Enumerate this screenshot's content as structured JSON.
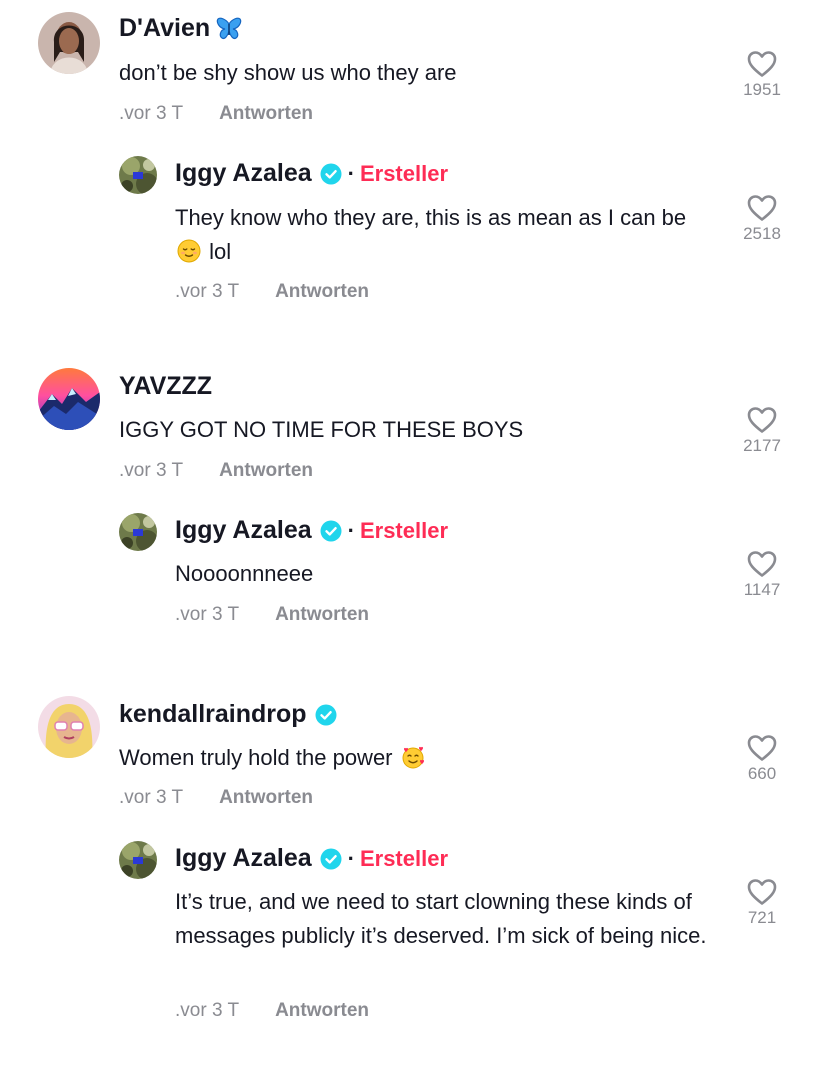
{
  "colors": {
    "creator": "#fe2c55",
    "verified": "#20d5ec",
    "muted": "#8a8b91"
  },
  "comments": [
    {
      "username": "D'Avien",
      "badge_icon": "butterfly-emoji",
      "text": "don’t be shy show us who they are",
      "time": ".vor 3 T",
      "reply_label": "Antworten",
      "likes": "1951",
      "reply": {
        "username": "Iggy Azalea",
        "creator_label": "Ersteller",
        "text_before_emoji": "They know who they are, this is as mean as I can be",
        "emoji": "relieved-face-emoji",
        "text_after_emoji": "lol",
        "time": ".vor 3 T",
        "reply_label": "Antworten",
        "likes": "2518"
      }
    },
    {
      "username": "YAVZZZ",
      "text": "IGGY GOT NO TIME FOR THESE BOYS",
      "time": ".vor 3 T",
      "reply_label": "Antworten",
      "likes": "2177",
      "reply": {
        "username": "Iggy Azalea",
        "creator_label": "Ersteller",
        "text": "Noooonnneee",
        "time": ".vor 3 T",
        "reply_label": "Antworten",
        "likes": "1147"
      }
    },
    {
      "username": "kendallraindrop",
      "text": "Women truly hold the power",
      "emoji": "smiling-face-with-hearts-emoji",
      "time": ".vor 3 T",
      "reply_label": "Antworten",
      "likes": "660",
      "reply": {
        "username": "Iggy Azalea",
        "creator_label": "Ersteller",
        "text": "It’s true, and we need to start clowning these kinds of messages publicly it’s deserved. I’m sick of being nice.",
        "time": ".vor 3 T",
        "reply_label": "Antworten",
        "likes": "721"
      }
    }
  ]
}
